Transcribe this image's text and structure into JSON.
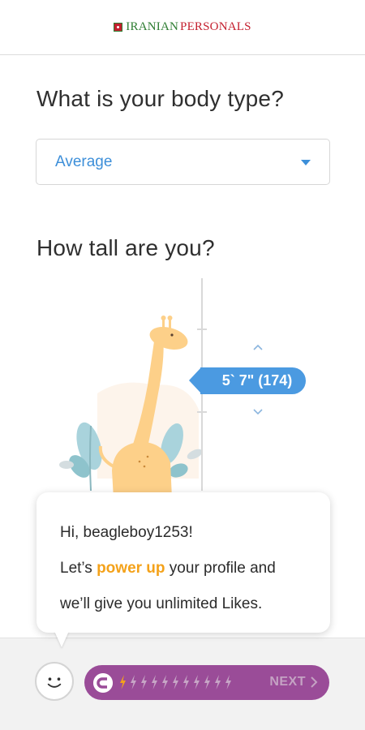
{
  "header": {
    "logo_part1": "IRANIAN",
    "logo_part2": "PERSONALS"
  },
  "body_type": {
    "question": "What is your body type?",
    "selected": "Average"
  },
  "height": {
    "question": "How tall are you?",
    "value": "5` 7\" (174)"
  },
  "bubble": {
    "greeting": "Hi, beagleboy1253!",
    "line2_before": "Let’s ",
    "line2_highlight": "power up",
    "line2_after": " your profile and",
    "line3": "we’ll give you unlimited Likes."
  },
  "progress": {
    "filled_bolts": 1,
    "total_bolts": 11,
    "next_label": "NEXT"
  },
  "colors": {
    "accent_blue": "#4b9ae1",
    "highlight_orange": "#f4a21a",
    "progress_purple": "#9a4c98"
  }
}
